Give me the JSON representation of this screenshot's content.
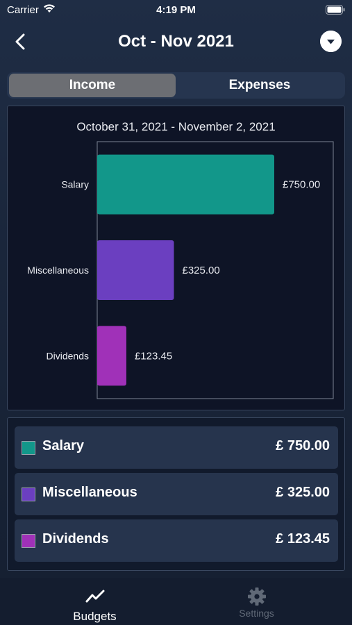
{
  "status_bar": {
    "carrier": "Carrier",
    "time": "4:19 PM"
  },
  "nav": {
    "title": "Oct - Nov 2021"
  },
  "segments": {
    "income": "Income",
    "expenses": "Expenses",
    "selected": "income"
  },
  "chart_data": {
    "type": "bar",
    "orientation": "horizontal",
    "subtitle": "October 31, 2021 - November 2, 2021",
    "categories": [
      "Salary",
      "Miscellaneous",
      "Dividends"
    ],
    "values": [
      750.0,
      325.0,
      123.45
    ],
    "value_labels": [
      "£750.00",
      "£325.00",
      "£123.45"
    ],
    "colors": [
      "#12978a",
      "#6b3fc0",
      "#a031b8"
    ],
    "xlim": [
      0,
      1000
    ],
    "grid": false
  },
  "list": {
    "items": [
      {
        "label": "Salary",
        "value": "£ 750.00",
        "color": "#12978a"
      },
      {
        "label": "Miscellaneous",
        "value": "£ 325.00",
        "color": "#6b3fc0"
      },
      {
        "label": "Dividends",
        "value": "£ 123.45",
        "color": "#a031b8"
      }
    ]
  },
  "tabbar": {
    "budgets": "Budgets",
    "settings": "Settings"
  }
}
